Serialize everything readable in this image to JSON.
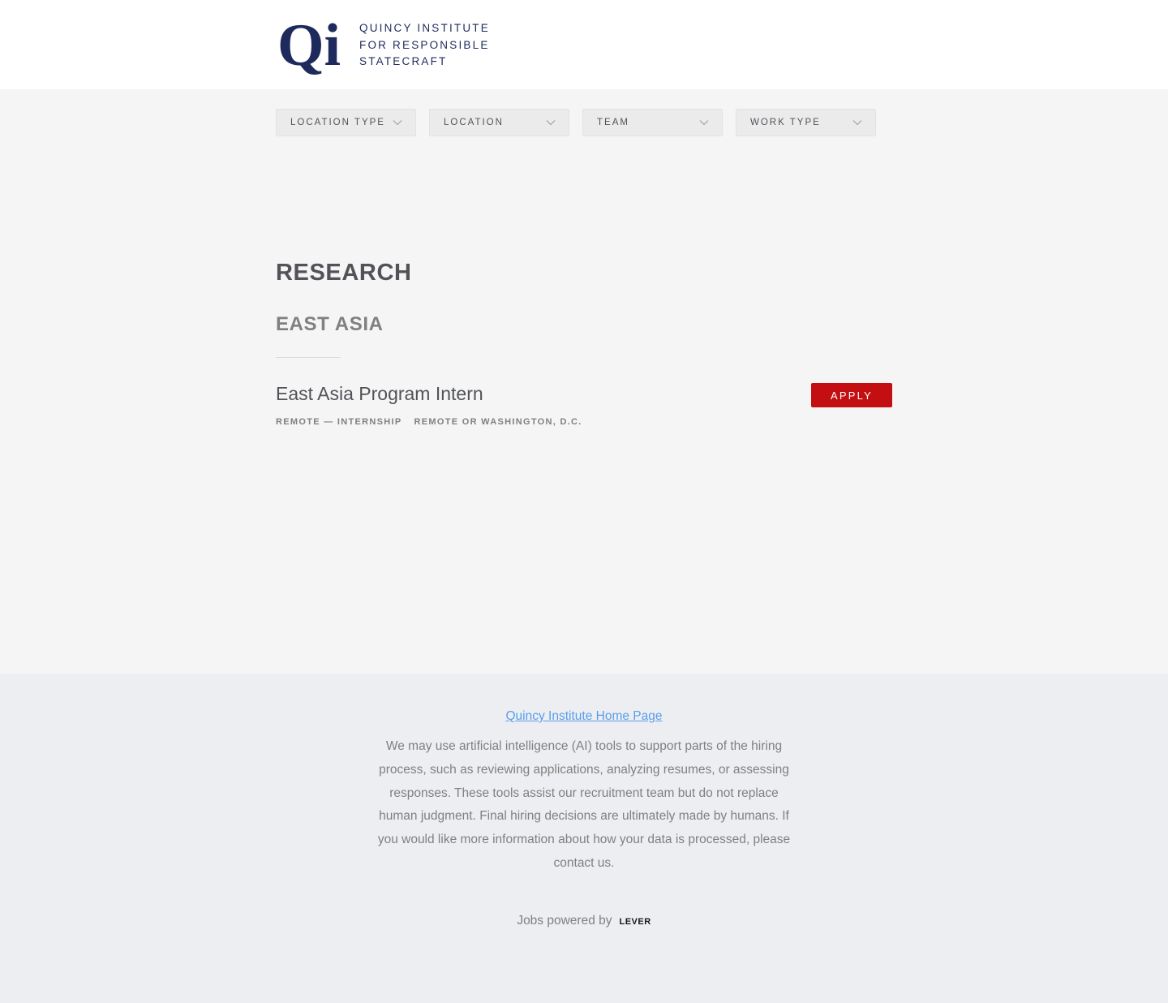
{
  "header": {
    "logo_mark_text": "Qi",
    "logo_lines": [
      "QUINCY INSTITUTE",
      "FOR RESPONSIBLE",
      "STATECRAFT"
    ],
    "brand_color": "#1f2a5c"
  },
  "filters": [
    {
      "label": "LOCATION TYPE",
      "icon": "chevron-down-icon"
    },
    {
      "label": "LOCATION",
      "icon": "chevron-down-icon"
    },
    {
      "label": "TEAM",
      "icon": "chevron-down-icon"
    },
    {
      "label": "WORK TYPE",
      "icon": "chevron-down-icon"
    }
  ],
  "section": {
    "title": "RESEARCH",
    "subtitle": "EAST ASIA"
  },
  "postings": [
    {
      "title": "East Asia Program Intern",
      "commitment": "REMOTE — INTERNSHIP",
      "location": "REMOTE OR WASHINGTON, D.C.",
      "apply_label": "APPLY"
    }
  ],
  "footer": {
    "home_link": "Quincy Institute Home Page",
    "ai_notice": "We may use artificial intelligence (AI) tools to support parts of the hiring process, such as reviewing applications, analyzing resumes, or assessing responses. These tools assist our recruitment team but do not replace human judgment. Final hiring decisions are ultimately made by humans. If you would like more information about how your data is processed, please contact us.",
    "powered_by": "Jobs powered by",
    "powered_brand": "LEVER"
  },
  "colors": {
    "apply_button": "#c40f12",
    "link": "#579eee",
    "page_background": "#f5f5f6",
    "footer_background": "#edeef1"
  }
}
